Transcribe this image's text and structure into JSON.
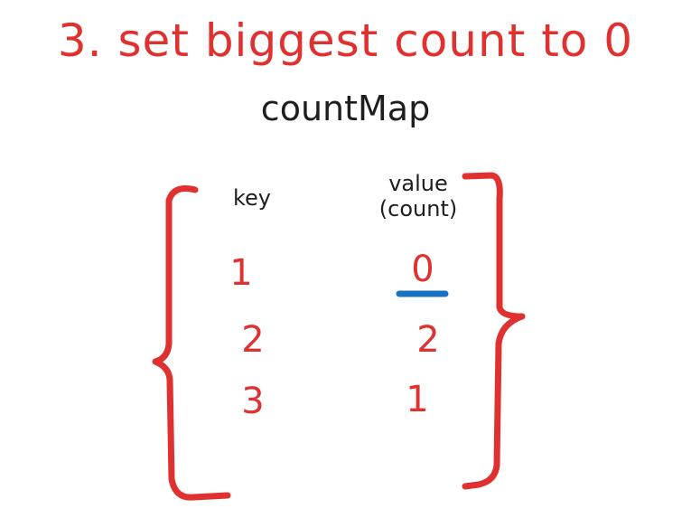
{
  "title": "3. set biggest count to 0",
  "map_name": "countMap",
  "table": {
    "key_header": "key",
    "value_header_line1": "value",
    "value_header_line2": "(count)",
    "rows": [
      {
        "key": "1",
        "value": "0"
      },
      {
        "key": "2",
        "value": "2"
      },
      {
        "key": "3",
        "value": "1"
      }
    ]
  },
  "colors": {
    "accent_red": "#e03131",
    "ink": "#1e1e1e",
    "highlight_blue": "#1971c2"
  }
}
